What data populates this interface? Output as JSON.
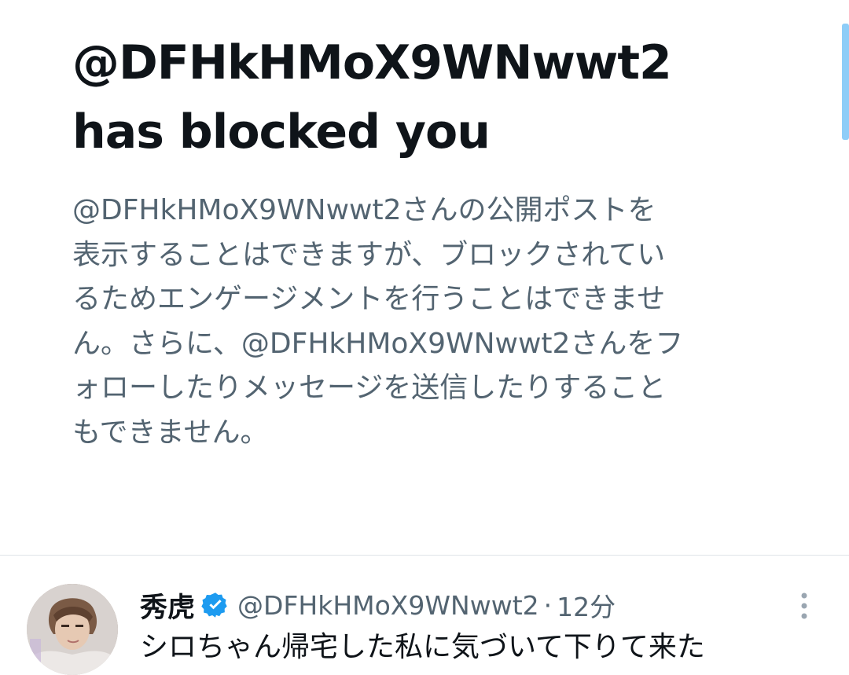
{
  "blocked_notice": {
    "title_line1": "@DFHkHMoX9WNwwt2",
    "title_line2": "has blocked you",
    "description_lines": [
      "@DFHkHMoX9WNwwt2さんの公開ポストを",
      "表示することはできますが、ブロックされてい",
      "るためエンゲージメントを行うことはできませ",
      "ん。さらに、@DFHkHMoX9WNwwt2さんをフ",
      "ォローしたりメッセージを送信したりすること",
      "もできません。"
    ]
  },
  "post": {
    "display_name": "秀虎",
    "handle": "@DFHkHMoX9WNwwt2",
    "separator": "·",
    "timestamp": "12分",
    "text": "シロちゃん帰宅した私に気づいて下りて来た",
    "avatar_icon": "user-avatar-photo",
    "verified_icon": "verified-badge-icon",
    "more_icon": "more-vertical-icon"
  },
  "colors": {
    "title": "#0f1419",
    "secondary_text": "#536471",
    "divider": "#dfe4e8",
    "verified": "#1d9bf0",
    "scrollbar": "#8ecdf8"
  }
}
